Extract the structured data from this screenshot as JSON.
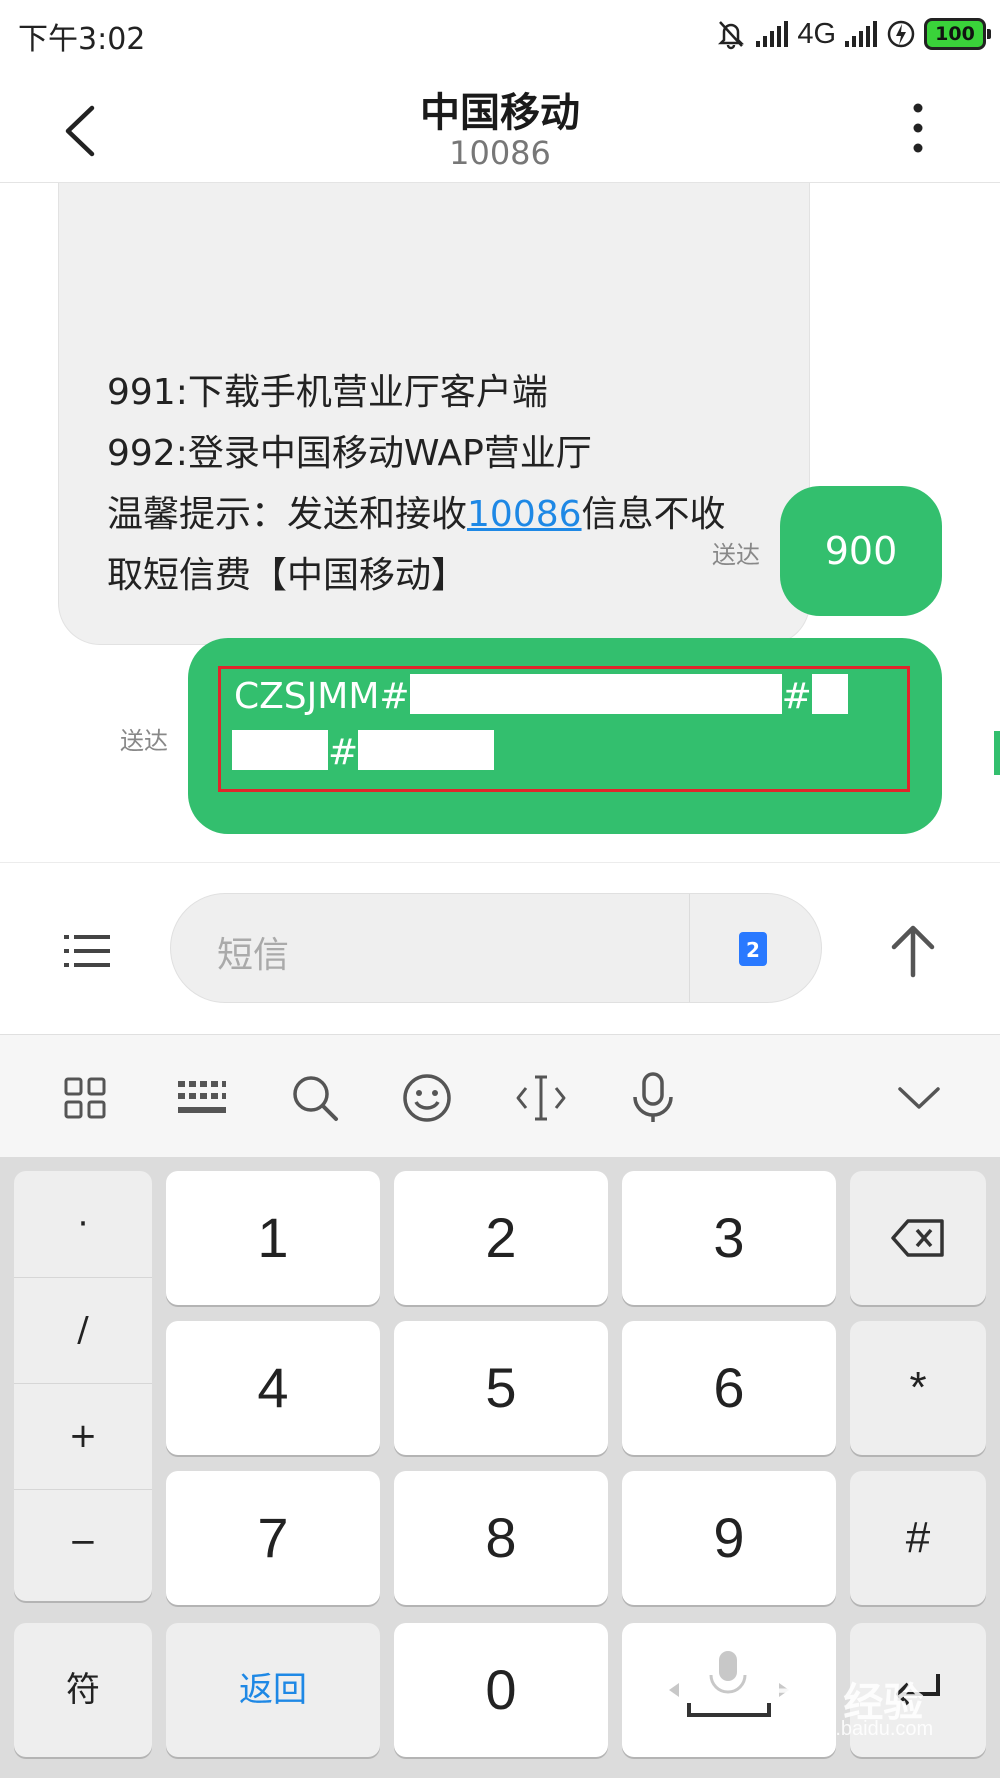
{
  "status_bar": {
    "time": "下午3:02",
    "network": "4G",
    "battery": "100",
    "icons": [
      "mute-icon",
      "signal-icon",
      "signal-icon",
      "charging-icon",
      "battery-icon"
    ]
  },
  "header": {
    "title": "中国移动",
    "subtitle": "10086",
    "back_icon": "chevron-left-icon",
    "more_icon": "more-vertical-icon"
  },
  "messages": {
    "incoming": {
      "lines": [
        "991:下载手机营业厅客户端",
        "992:登录中国移动WAP营业厅"
      ],
      "tip_prefix": "温馨提示：发送和接收",
      "tip_link": "10086",
      "tip_suffix": "信息不收",
      "last_line": "取短信费【中国移动】"
    },
    "outgoing": [
      {
        "text": "900",
        "status": "送达"
      },
      {
        "line1": "CZSJMM#",
        "line1_mid": "#",
        "line2_mid": "#",
        "status": "送达"
      }
    ]
  },
  "composer": {
    "placeholder": "短信",
    "sim_badge": "2",
    "menu_icon": "list-icon",
    "send_icon": "arrow-up-icon"
  },
  "keyboard_toolbar": {
    "tools": [
      "grid-icon",
      "keyboard-icon",
      "search-icon",
      "emoji-icon",
      "cursor-icon",
      "mic-icon",
      "chevron-down-icon"
    ]
  },
  "keyboard": {
    "symbols": [
      "·",
      "/",
      "+",
      "−"
    ],
    "digits": [
      "1",
      "2",
      "3",
      "4",
      "5",
      "6",
      "7",
      "8",
      "9",
      "0"
    ],
    "right_keys": [
      "*",
      "#"
    ],
    "symbol_key": "符",
    "return_key": "返回",
    "watermark": "Bai 经验",
    "watermark_sub": "jingyan.baidu.com",
    "colors": {
      "accent_blue": "#1e88e5",
      "bubble_green": "#33bf6e",
      "highlight_red": "#e0262b"
    }
  }
}
